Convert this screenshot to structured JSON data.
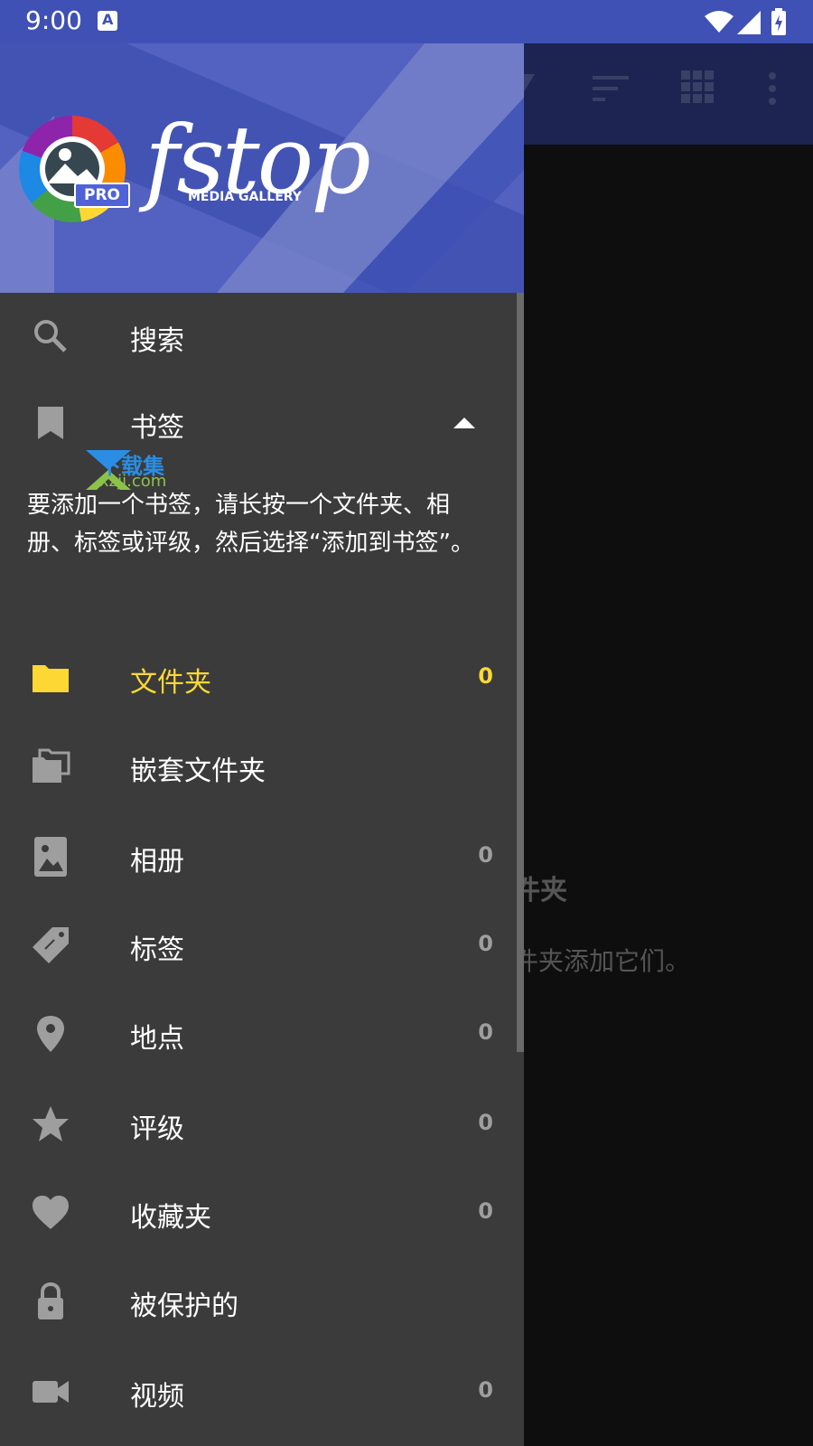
{
  "status_bar": {
    "time": "9:00"
  },
  "background": {
    "empty_title": "件夹",
    "empty_subtitle": "件夹添加它们。"
  },
  "drawer": {
    "brand": "fstop",
    "brand_sub": "MEDIA GALLERY",
    "badge": "PRO",
    "watermark": {
      "line1": "下载集",
      "line2": "xzji.com"
    },
    "search": {
      "label": "搜索",
      "icon": "search-icon"
    },
    "bookmarks": {
      "label": "书签",
      "hint": "要添加一个书签，请长按一个文件夹、相册、标签或评级，然后选择“添加到书签”。"
    },
    "items": [
      {
        "label": "文件夹",
        "count": "0",
        "icon": "folder-icon",
        "active": true
      },
      {
        "label": "嵌套文件夹",
        "count": "",
        "icon": "nested-folders-icon"
      },
      {
        "label": "相册",
        "count": "0",
        "icon": "album-icon"
      },
      {
        "label": "标签",
        "count": "0",
        "icon": "tag-icon"
      },
      {
        "label": "地点",
        "count": "0",
        "icon": "location-pin-icon"
      },
      {
        "label": "评级",
        "count": "0",
        "icon": "star-icon"
      },
      {
        "label": "收藏夹",
        "count": "0",
        "icon": "heart-icon"
      },
      {
        "label": "被保护的",
        "count": "",
        "icon": "lock-icon"
      },
      {
        "label": "视频",
        "count": "0",
        "icon": "video-camera-icon"
      }
    ]
  },
  "colors": {
    "drawer_bg": "#3b3b3b",
    "header_bg": "#5361c0",
    "accent_active": "#fdd835",
    "statusbar": "#3f51b5"
  }
}
